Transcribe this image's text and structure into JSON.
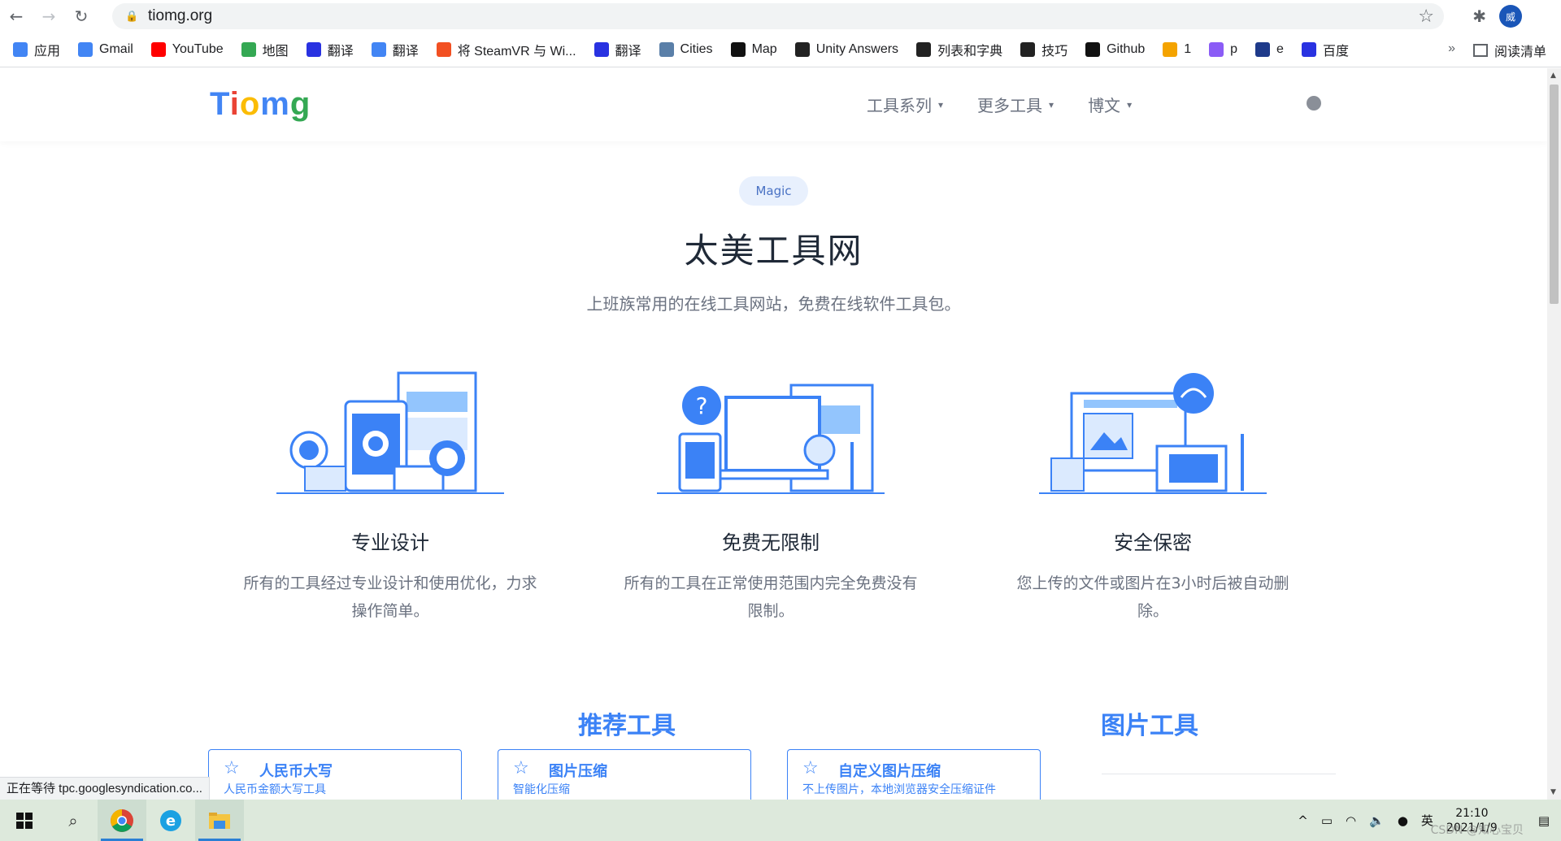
{
  "browser": {
    "url": "tiomg.org",
    "profile_initial": "威",
    "bookmarks": [
      {
        "label": "应用",
        "icon": "apps-grid-icon",
        "color": "#4285f4"
      },
      {
        "label": "Gmail",
        "icon": "google-g-icon",
        "color": "#4285f4"
      },
      {
        "label": "YouTube",
        "icon": "youtube-icon",
        "color": "#ff0000"
      },
      {
        "label": "地图",
        "icon": "maps-pin-icon",
        "color": "#34a853"
      },
      {
        "label": "翻译",
        "icon": "baidu-paw-icon",
        "color": "#2932e1"
      },
      {
        "label": "翻译",
        "icon": "google-translate-icon",
        "color": "#4285f4"
      },
      {
        "label": "将 SteamVR 与 Wi...",
        "icon": "microsoft-icon",
        "color": "#f25022"
      },
      {
        "label": "翻译",
        "icon": "baidu-paw-icon",
        "color": "#2932e1"
      },
      {
        "label": "Cities",
        "icon": "cities-icon",
        "color": "#5a7fa8"
      },
      {
        "label": "Map",
        "icon": "c-logo-icon",
        "color": "#111111"
      },
      {
        "label": "Unity Answers",
        "icon": "unity-icon",
        "color": "#222222"
      },
      {
        "label": "列表和字典",
        "icon": "vscode-icon",
        "color": "#222222"
      },
      {
        "label": "技巧",
        "icon": "vscode-icon",
        "color": "#222222"
      },
      {
        "label": "Github",
        "icon": "github-icon",
        "color": "#111111"
      },
      {
        "label": "1",
        "icon": "colorful-icon",
        "color": "#f4a300"
      },
      {
        "label": "p",
        "icon": "link-icon",
        "color": "#8b5cf6"
      },
      {
        "label": "e",
        "icon": "chart-icon",
        "color": "#1e3a8a"
      },
      {
        "label": "百度",
        "icon": "baidu-paw-icon",
        "color": "#2932e1"
      }
    ],
    "more": "»",
    "reading_list": "阅读清单",
    "status_text": "正在等待 tpc.googlesyndication.co..."
  },
  "site": {
    "logo_letters": [
      "T",
      "i",
      "o",
      "m",
      "g"
    ],
    "nav": [
      {
        "label": "工具系列"
      },
      {
        "label": "更多工具"
      },
      {
        "label": "博文"
      }
    ],
    "badge": "Magic",
    "title": "太美工具网",
    "subtitle": "上班族常用的在线工具网站，免费在线软件工具包。",
    "features": [
      {
        "title": "专业设计",
        "desc": "所有的工具经过专业设计和使用优化，力求操作简单。"
      },
      {
        "title": "免费无限制",
        "desc": "所有的工具在正常使用范围内完全免费没有限制。"
      },
      {
        "title": "安全保密",
        "desc": "您上传的文件或图片在3小时后被自动删除。"
      }
    ],
    "recommended_title": "推荐工具",
    "image_tools_title": "图片工具",
    "tools": [
      {
        "name": "人民币大写",
        "desc": "人民币金额大写工具"
      },
      {
        "name": "图片压缩",
        "desc": "智能化压缩"
      },
      {
        "name": "自定义图片压缩",
        "desc": "不上传图片，本地浏览器安全压缩证件"
      }
    ]
  },
  "taskbar": {
    "ime": "英",
    "time": "21:10",
    "date": "2021/1/9",
    "watermark": "CSDN @知心宝贝"
  },
  "colors": {
    "accent": "#3b82f6",
    "badge_bg": "#e8f0fd"
  }
}
